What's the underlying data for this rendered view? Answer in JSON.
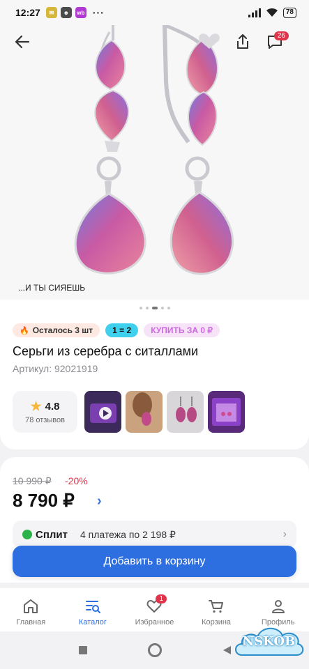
{
  "status_bar": {
    "time": "12:27",
    "battery": "78",
    "more": "···"
  },
  "hero": {
    "caption": "...И ТЫ СИЯЕШЬ",
    "share_icon": "share-icon",
    "chat_badge": "26",
    "slide_count": 5,
    "active_slide": 2
  },
  "product": {
    "chips": {
      "stock": "Осталось 3 шт",
      "promo": "1 = 2",
      "buy": "КУПИТЬ ЗА 0 ₽"
    },
    "title": "Серьги из серебра с ситаллами",
    "article": "Артикул: 92021919",
    "rating": {
      "value": "4.8",
      "reviews": "78 отзывов"
    }
  },
  "price": {
    "old": "10 990 ₽",
    "discount": "-20%",
    "current": "8 790 ₽",
    "split_name": "Сплит",
    "split_text": "4 платежа по 2 198 ₽"
  },
  "cta": {
    "add_to_cart": "Добавить в корзину"
  },
  "nav": {
    "items": [
      {
        "label": "Главная",
        "icon": "home-icon"
      },
      {
        "label": "Каталог",
        "icon": "catalog-icon"
      },
      {
        "label": "Избранное",
        "icon": "heart-icon",
        "badge": "1"
      },
      {
        "label": "Корзина",
        "icon": "cart-icon"
      },
      {
        "label": "Профиль",
        "icon": "profile-icon"
      }
    ],
    "active_index": 1
  },
  "watermark": {
    "text": "NSKOB"
  },
  "colors": {
    "accent": "#2d6fe0",
    "sale": "#e0344a",
    "promo": "#3fd0ee",
    "buy": "#ce6adf"
  }
}
